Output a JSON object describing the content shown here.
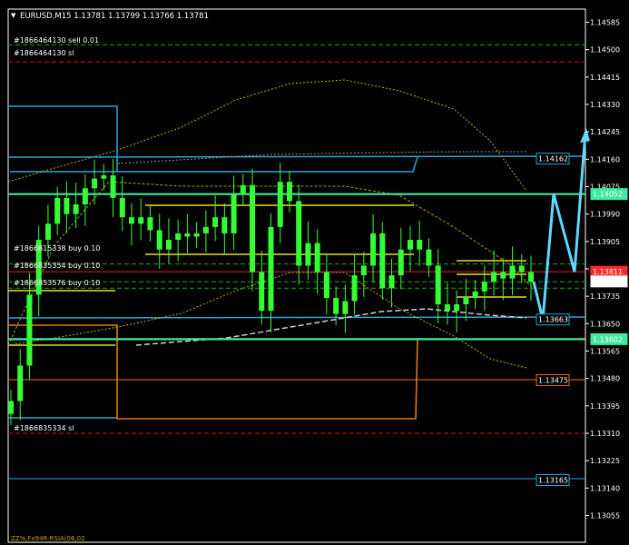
{
  "header": {
    "title": "EURUSD,M15  1.13781 1.13799 1.13766 1.13781"
  },
  "colors": {
    "background": "#000000",
    "candle": "#33ff33",
    "sell_level": "#18a818",
    "sl_level": "#c81e1e",
    "zone_blue": "#2aa6d8",
    "zone_orange": "#e07a10",
    "sr_green": "#40e8a0",
    "yellow": "#e8e020",
    "dotted_yellow": "#c8b000",
    "ma_white": "#cfcfcf",
    "arrow": "#5fd8ff",
    "price_tag": "#ffffff",
    "red_tag": "#ff2a2a"
  },
  "order_labels": [
    "#1866464130 sell 0.01",
    "#1866464130 sl",
    "#1866815338 buy 0.10",
    "#1866835354 buy 0.10",
    "#1866853576 buy 0.10",
    "#1866835334 sl"
  ],
  "price_tags": [
    {
      "price": 1.14162,
      "label": "1.14162",
      "color": "#2aa6d8"
    },
    {
      "price": 1.14052,
      "label": "1.14052",
      "color": "#40e8a0"
    },
    {
      "price": 1.13811,
      "label": "1.13811",
      "color": "#ff2a2a"
    },
    {
      "price": 1.13781,
      "label": "1.13781",
      "color": "#ffffff"
    },
    {
      "price": 1.13663,
      "label": "1.13663",
      "color": "#2aa6d8"
    },
    {
      "price": 1.13602,
      "label": "1.13602",
      "color": "#40e8a0"
    },
    {
      "price": 1.13475,
      "label": "1.13475",
      "color": "#e07a10"
    },
    {
      "price": 1.13165,
      "label": "1.13165",
      "color": "#2aa6d8"
    }
  ],
  "footer_text": "ZZ%,Fx94R-RSIA(06,02",
  "chart_data": {
    "type": "candlestick",
    "symbol": "EURUSD",
    "timeframe": "M15",
    "ylim": [
      1.1303,
      1.146
    ],
    "yticks": [
      "1.14585",
      "1.14500",
      "1.14415",
      "1.14330",
      "1.14245",
      "1.14160",
      "1.14075",
      "1.13990",
      "1.13905",
      "1.13820",
      "1.13735",
      "1.13650",
      "1.13565",
      "1.13480",
      "1.13395",
      "1.13310",
      "1.13225",
      "1.13140",
      "1.13055"
    ],
    "close_path": [
      1.1341,
      1.1352,
      1.1374,
      1.1391,
      1.1396,
      1.1404,
      1.1399,
      1.1402,
      1.1407,
      1.141,
      1.1411,
      1.1404,
      1.1398,
      1.1396,
      1.1398,
      1.1394,
      1.1388,
      1.1391,
      1.1393,
      1.1392,
      1.1393,
      1.1395,
      1.1398,
      1.1393,
      1.1405,
      1.1408,
      1.1381,
      1.1369,
      1.1395,
      1.1409,
      1.1403,
      1.1383,
      1.139,
      1.1381,
      1.1373,
      1.1368,
      1.1372,
      1.138,
      1.1383,
      1.1393,
      1.1376,
      1.138,
      1.1388,
      1.1391,
      1.1388,
      1.1383,
      1.1371,
      1.1369,
      1.1371,
      1.1373,
      1.1375,
      1.1378,
      1.1381,
      1.1379,
      1.1383,
      1.1381,
      1.1378
    ],
    "sr_levels": [
      1.14052,
      1.13602
    ],
    "order_levels": [
      {
        "price": 1.14515,
        "kind": "sell"
      },
      {
        "price": 1.14462,
        "kind": "sl"
      },
      {
        "price": 1.13835,
        "kind": "buy"
      },
      {
        "price": 1.1376,
        "kind": "buy"
      },
      {
        "price": 1.1378,
        "kind": "buy"
      },
      {
        "price": 1.1331,
        "kind": "sl"
      }
    ],
    "projection": [
      1.1378,
      1.13663,
      1.14052,
      1.13811,
      1.14245
    ]
  }
}
